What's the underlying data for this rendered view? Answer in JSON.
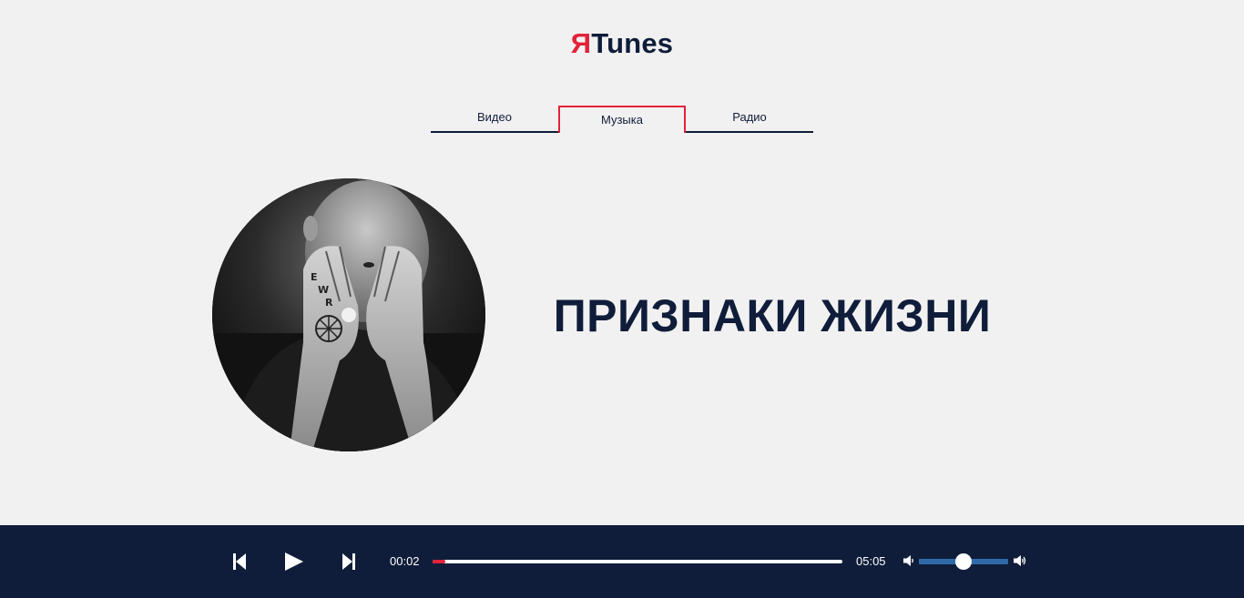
{
  "header": {
    "logo_accent": "Я",
    "logo_text": "Tunes"
  },
  "tabs": [
    {
      "label": "Видео",
      "active": false
    },
    {
      "label": "Музыка",
      "active": true
    },
    {
      "label": "Радио",
      "active": false
    }
  ],
  "track": {
    "title": "ПРИЗНАКИ ЖИЗНИ"
  },
  "player": {
    "current_time": "00:02",
    "duration": "05:05",
    "progress_fraction": 0.007,
    "volume_fraction": 0.5
  },
  "icons": {
    "prev": "skip-back-icon",
    "play": "play-icon",
    "next": "skip-forward-icon",
    "volume_low": "volume-low-icon",
    "volume_high": "volume-high-icon"
  },
  "colors": {
    "accent": "#e3223a",
    "navy": "#0f1d3a",
    "background": "#f2f1f1",
    "volume_track": "#2f6aa8"
  }
}
